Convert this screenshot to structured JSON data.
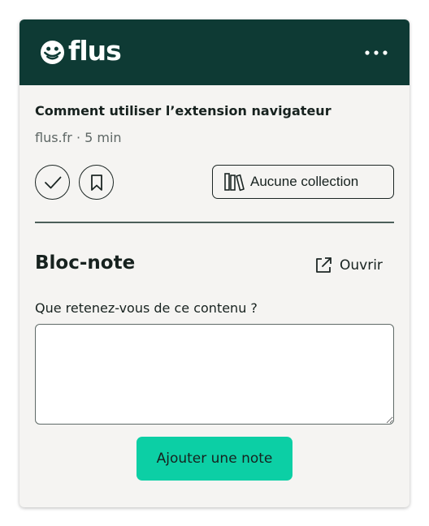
{
  "app": {
    "logo_text": "flus"
  },
  "article": {
    "title": "Comment utiliser l’extension navigateur",
    "meta": "flus.fr · 5 min"
  },
  "actions": {
    "collection_label": "Aucune collection"
  },
  "notepad": {
    "title": "Bloc-note",
    "open_label": "Ouvrir",
    "question": "Que retenez-vous de ce contenu ?",
    "note_value": "",
    "submit_label": "Ajouter une note"
  },
  "colors": {
    "header_bg": "#0e3a34",
    "panel_bg": "#f5f4f2",
    "accent": "#0ccfa5",
    "text": "#17221f"
  },
  "icons": {
    "logo": "smiley-logo-icon",
    "menu": "more-horizontal-icon",
    "read": "check-icon",
    "later": "bookmark-icon",
    "collection": "books-icon",
    "open": "external-link-icon"
  }
}
